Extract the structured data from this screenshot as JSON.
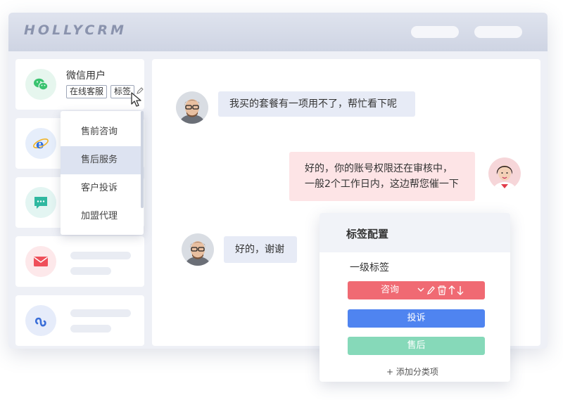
{
  "app": {
    "brand": "HOLLYCRM"
  },
  "sidebar": {
    "user": {
      "name": "微信用户",
      "chips": [
        "在线客服",
        "标签"
      ]
    }
  },
  "tag_dropdown": {
    "items": [
      "售前咨询",
      "售后服务",
      "客户投诉",
      "加盟代理"
    ],
    "selected_index": 1
  },
  "chat": {
    "messages": [
      {
        "side": "left",
        "text": "我买的套餐有一项用不了，帮忙看下呢"
      },
      {
        "side": "right",
        "lines": [
          "好的，你的账号权限还在审核中，",
          "一般2个工作日内，这边帮您催一下"
        ]
      },
      {
        "side": "left",
        "text": "好的，谢谢"
      }
    ]
  },
  "tag_config": {
    "title": "标签配置",
    "level_label": "一级标签",
    "tags": [
      {
        "label": "咨询",
        "color": "#f06a73"
      },
      {
        "label": "投诉",
        "color": "#4f84f0"
      },
      {
        "label": "售后",
        "color": "#86d9b9"
      }
    ],
    "add_label": "+ 添加分类项"
  },
  "colors": {
    "accent_blue": "#4f84f0",
    "accent_red": "#f06a73",
    "accent_green": "#86d9b9"
  }
}
